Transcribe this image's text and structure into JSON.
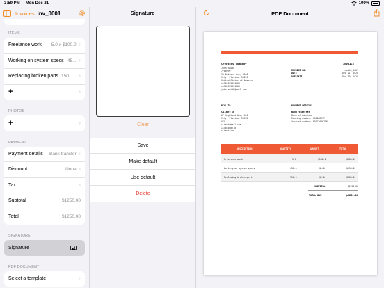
{
  "status": {
    "time": "3:59 PM",
    "date": "Mon Dec 21",
    "battery": "100%"
  },
  "left": {
    "back": "Invoices",
    "title": "inv_0001",
    "sections": {
      "items": "ITEMS",
      "photos": "PHOTOS",
      "payment": "PAYMENT",
      "signature": "SIGNATURE",
      "pdf": "PDF DOCUMENT"
    },
    "items": [
      {
        "label": "Freelance work",
        "value": "5.0 x $100.0"
      },
      {
        "label": "Working on system specs",
        "value": "45..."
      },
      {
        "label": "Replacing broken parts",
        "value": "150.0..."
      }
    ],
    "payment": [
      {
        "label": "Payment details",
        "value": "Bank transfer"
      },
      {
        "label": "Discount",
        "value": "None"
      },
      {
        "label": "Tax",
        "value": ""
      },
      {
        "label": "Subtotal",
        "value": "$1250.00"
      },
      {
        "label": "Total",
        "value": "$1250.00"
      }
    ],
    "signature_label": "Signature",
    "pdf_label": "Select a template"
  },
  "middle": {
    "title": "Signature",
    "clear": "Clear",
    "actions": {
      "save": "Save",
      "make_default": "Make default",
      "use_default": "Use default",
      "delete": "Delete"
    }
  },
  "right": {
    "title": "PDF Document",
    "doc": {
      "company": "Creators Company",
      "company_lines": [
        "John Smith",
        "7788999",
        "96 Oakland Ave, 4560",
        "City, Florida, 33074",
        "United States of America",
        "+1505555554889",
        "+1505555554889",
        "john.smith@mail.com"
      ],
      "heading": "INVOICE",
      "meta_labels": [
        "INVOICE NO.",
        "DATE",
        "DUE DATE"
      ],
      "meta_values": [
        "jsmith_0001",
        "Dec 21, 2020",
        "Dec 30, 2020"
      ],
      "bill_to": "BILL TO",
      "client": "Client X",
      "client_lines": [
        "67 Highland Ave, 446",
        "City, Florida, 35378",
        "USA",
        "client@mail.com",
        "+1505468778",
        "client.com"
      ],
      "payment_details": "PAYMENT DETAILS",
      "payment_method": "Bank transfer",
      "payment_lines": [
        "Bank of America",
        "Routing number: 455668777",
        "Account number: 00112666788"
      ],
      "columns": [
        "DESCRIPTION",
        "QUANTITY",
        "AMOUNT",
        "TOTAL"
      ],
      "rows": [
        [
          "Freelance work",
          "5.0",
          "$100.0",
          "$500.0"
        ],
        [
          "Working on system specs",
          "450.0",
          "$1.0",
          "$450.0"
        ],
        [
          "Replacing broken parts",
          "150.0",
          "$2.0",
          "$300.0"
        ]
      ],
      "subtotal_label": "SUBTOTAL",
      "subtotal": "$1250.00",
      "total_label": "TOTAL DUE",
      "total": "$1250.00"
    }
  },
  "colors": {
    "accent": "#f08a24",
    "doc_accent": "#ef5a35",
    "destructive": "#e5352b"
  }
}
